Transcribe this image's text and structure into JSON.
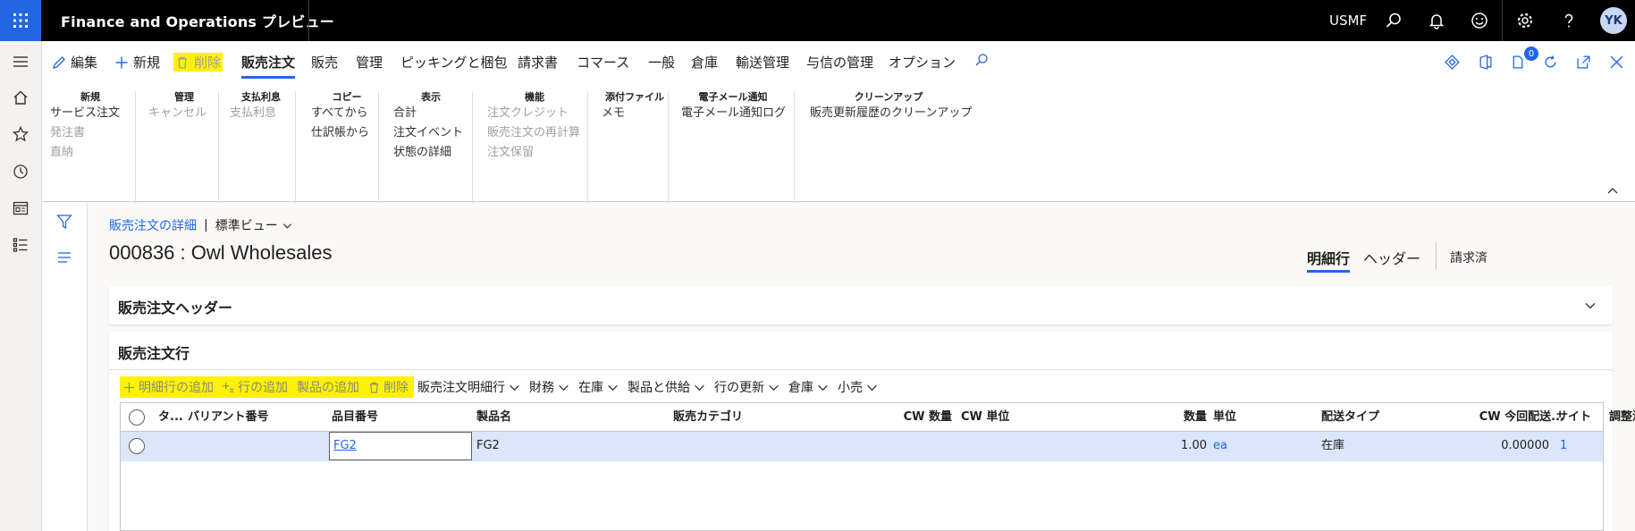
{
  "topbar": {
    "app_title": "Finance and Operations プレビュー",
    "company": "USMF",
    "avatar_initials": "YK",
    "waffle_icon": "waffle-icon",
    "icons": [
      "search-icon",
      "bell-icon",
      "smiley-icon",
      "gear-icon",
      "help-icon"
    ]
  },
  "leftnav": {
    "icons": [
      "hamburger-icon",
      "home-icon",
      "star-icon",
      "clock-icon",
      "workspace-icon",
      "list-icon"
    ]
  },
  "actionpane": {
    "edit_label": "編集",
    "new_label": "新規",
    "delete_label": "削除",
    "tabs": [
      "販売注文",
      "販売",
      "管理",
      "ピッキングと梱包",
      "請求書",
      "コマース",
      "一般",
      "倉庫",
      "輸送管理",
      "与信の管理",
      "オプション"
    ],
    "badge_count": "0",
    "groups": [
      {
        "title": "新規",
        "items": [
          "サービス注文",
          "発注書",
          "直納"
        ]
      },
      {
        "title": "管理",
        "items": [
          "キャンセル"
        ]
      },
      {
        "title": "支払利息",
        "items": [
          "支払利息"
        ]
      },
      {
        "title": "コピー",
        "items": [
          "すべてから",
          "仕訳帳から"
        ]
      },
      {
        "title": "表示",
        "items": [
          "合計",
          "注文イベント",
          "状態の詳細"
        ]
      },
      {
        "title": "機能",
        "items": [
          "注文クレジット",
          "販売注文の再計算",
          "注文保留"
        ]
      },
      {
        "title": "添付ファイル",
        "items": [
          "メモ"
        ]
      },
      {
        "title": "電子メール通知",
        "items": [
          "電子メール通知ログ"
        ]
      },
      {
        "title": "クリーンアップ",
        "items": [
          "販売更新履歴のクリーンアップ"
        ]
      }
    ]
  },
  "page": {
    "breadcrumb_link": "販売注文の詳細",
    "breadcrumb_sep": "|",
    "view_name": "標準ビュー",
    "title": "000836 : Owl Wholesales",
    "view_tabs": [
      "明細行",
      "ヘッダー",
      "請求済"
    ]
  },
  "header_fasttab": {
    "title": "販売注文ヘッダー"
  },
  "lines_fasttab": {
    "title": "販売注文行",
    "toolbar": {
      "add_line": "明細行の追加",
      "add_lines": "行の追加",
      "add_products": "製品の追加",
      "remove": "削除",
      "menus": [
        "販売注文明細行",
        "財務",
        "在庫",
        "製品と供給",
        "行の更新",
        "倉庫",
        "小売"
      ]
    },
    "columns": {
      "type": "タ...",
      "variant": "バリアント番号",
      "item": "品目番号",
      "product_name": "製品名",
      "sales_category": "販売カテゴリ",
      "cw_qty": "CW 数量",
      "cw_unit": "CW 単位",
      "qty": "数量",
      "unit": "単位",
      "delivery_type": "配送タイプ",
      "cw_deliver_now": "CW 今回配送...",
      "adj_price": "調整済単価",
      "site": "サイト"
    },
    "rows": [
      {
        "item": "FG2",
        "product_name": "FG2",
        "qty": "1.00",
        "unit": "ea",
        "delivery_type": "在庫",
        "adj_price": "0.00000",
        "site": "1"
      }
    ]
  }
}
